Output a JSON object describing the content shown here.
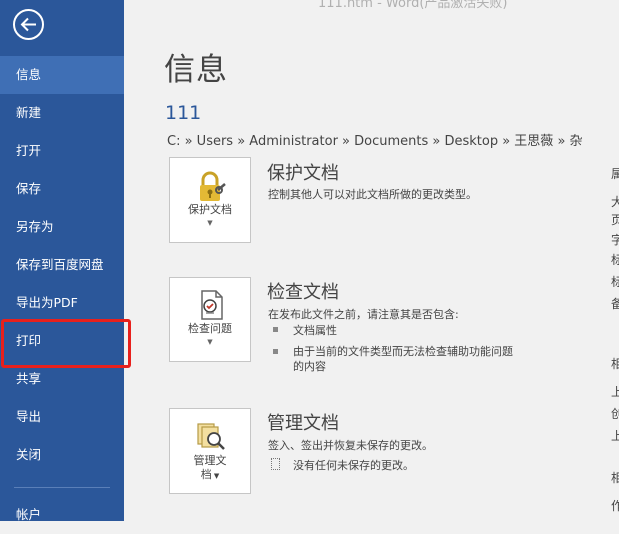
{
  "window_title": "111.htm - Word(产品激活失败)",
  "sidebar": {
    "items": [
      {
        "label": "信息"
      },
      {
        "label": "新建"
      },
      {
        "label": "打开"
      },
      {
        "label": "保存"
      },
      {
        "label": "另存为"
      },
      {
        "label": "保存到百度网盘"
      },
      {
        "label": "导出为PDF"
      },
      {
        "label": "打印"
      },
      {
        "label": "共享"
      },
      {
        "label": "导出"
      },
      {
        "label": "关闭"
      },
      {
        "label": "帐户"
      }
    ],
    "active": "信息",
    "highlighted": "打印"
  },
  "main": {
    "title": "信息",
    "doc_name": "111",
    "path": "C: » Users » Administrator » Documents » Desktop » 王思薇 » 杂",
    "sections": [
      {
        "button_label": "保护文档",
        "title": "保护文档",
        "desc": "控制其他人可以对此文档所做的更改类型。"
      },
      {
        "button_label": "检查问题",
        "title": "检查文档",
        "desc": "在发布此文件之前，请注意其是否包含:",
        "bullets": [
          "文档属性",
          "由于当前的文件类型而无法检查辅助功能问题",
          "的内容"
        ]
      },
      {
        "button_label_line1": "管理文",
        "button_label_line2": "档",
        "title": "管理文档",
        "desc": "签入、签出并恢复未保存的更改。",
        "note": "没有任何未保存的更改。"
      }
    ]
  },
  "right_panel_glyphs": [
    "属",
    "大",
    "页",
    "字",
    "标",
    "标",
    "备",
    "相",
    "上",
    "创",
    "上",
    "相",
    "作"
  ],
  "colors": {
    "sidebar_bg": "#2b579a",
    "sidebar_active": "#3f6fb5",
    "highlight_border": "#e8201c",
    "accent_text": "#2b579a"
  }
}
